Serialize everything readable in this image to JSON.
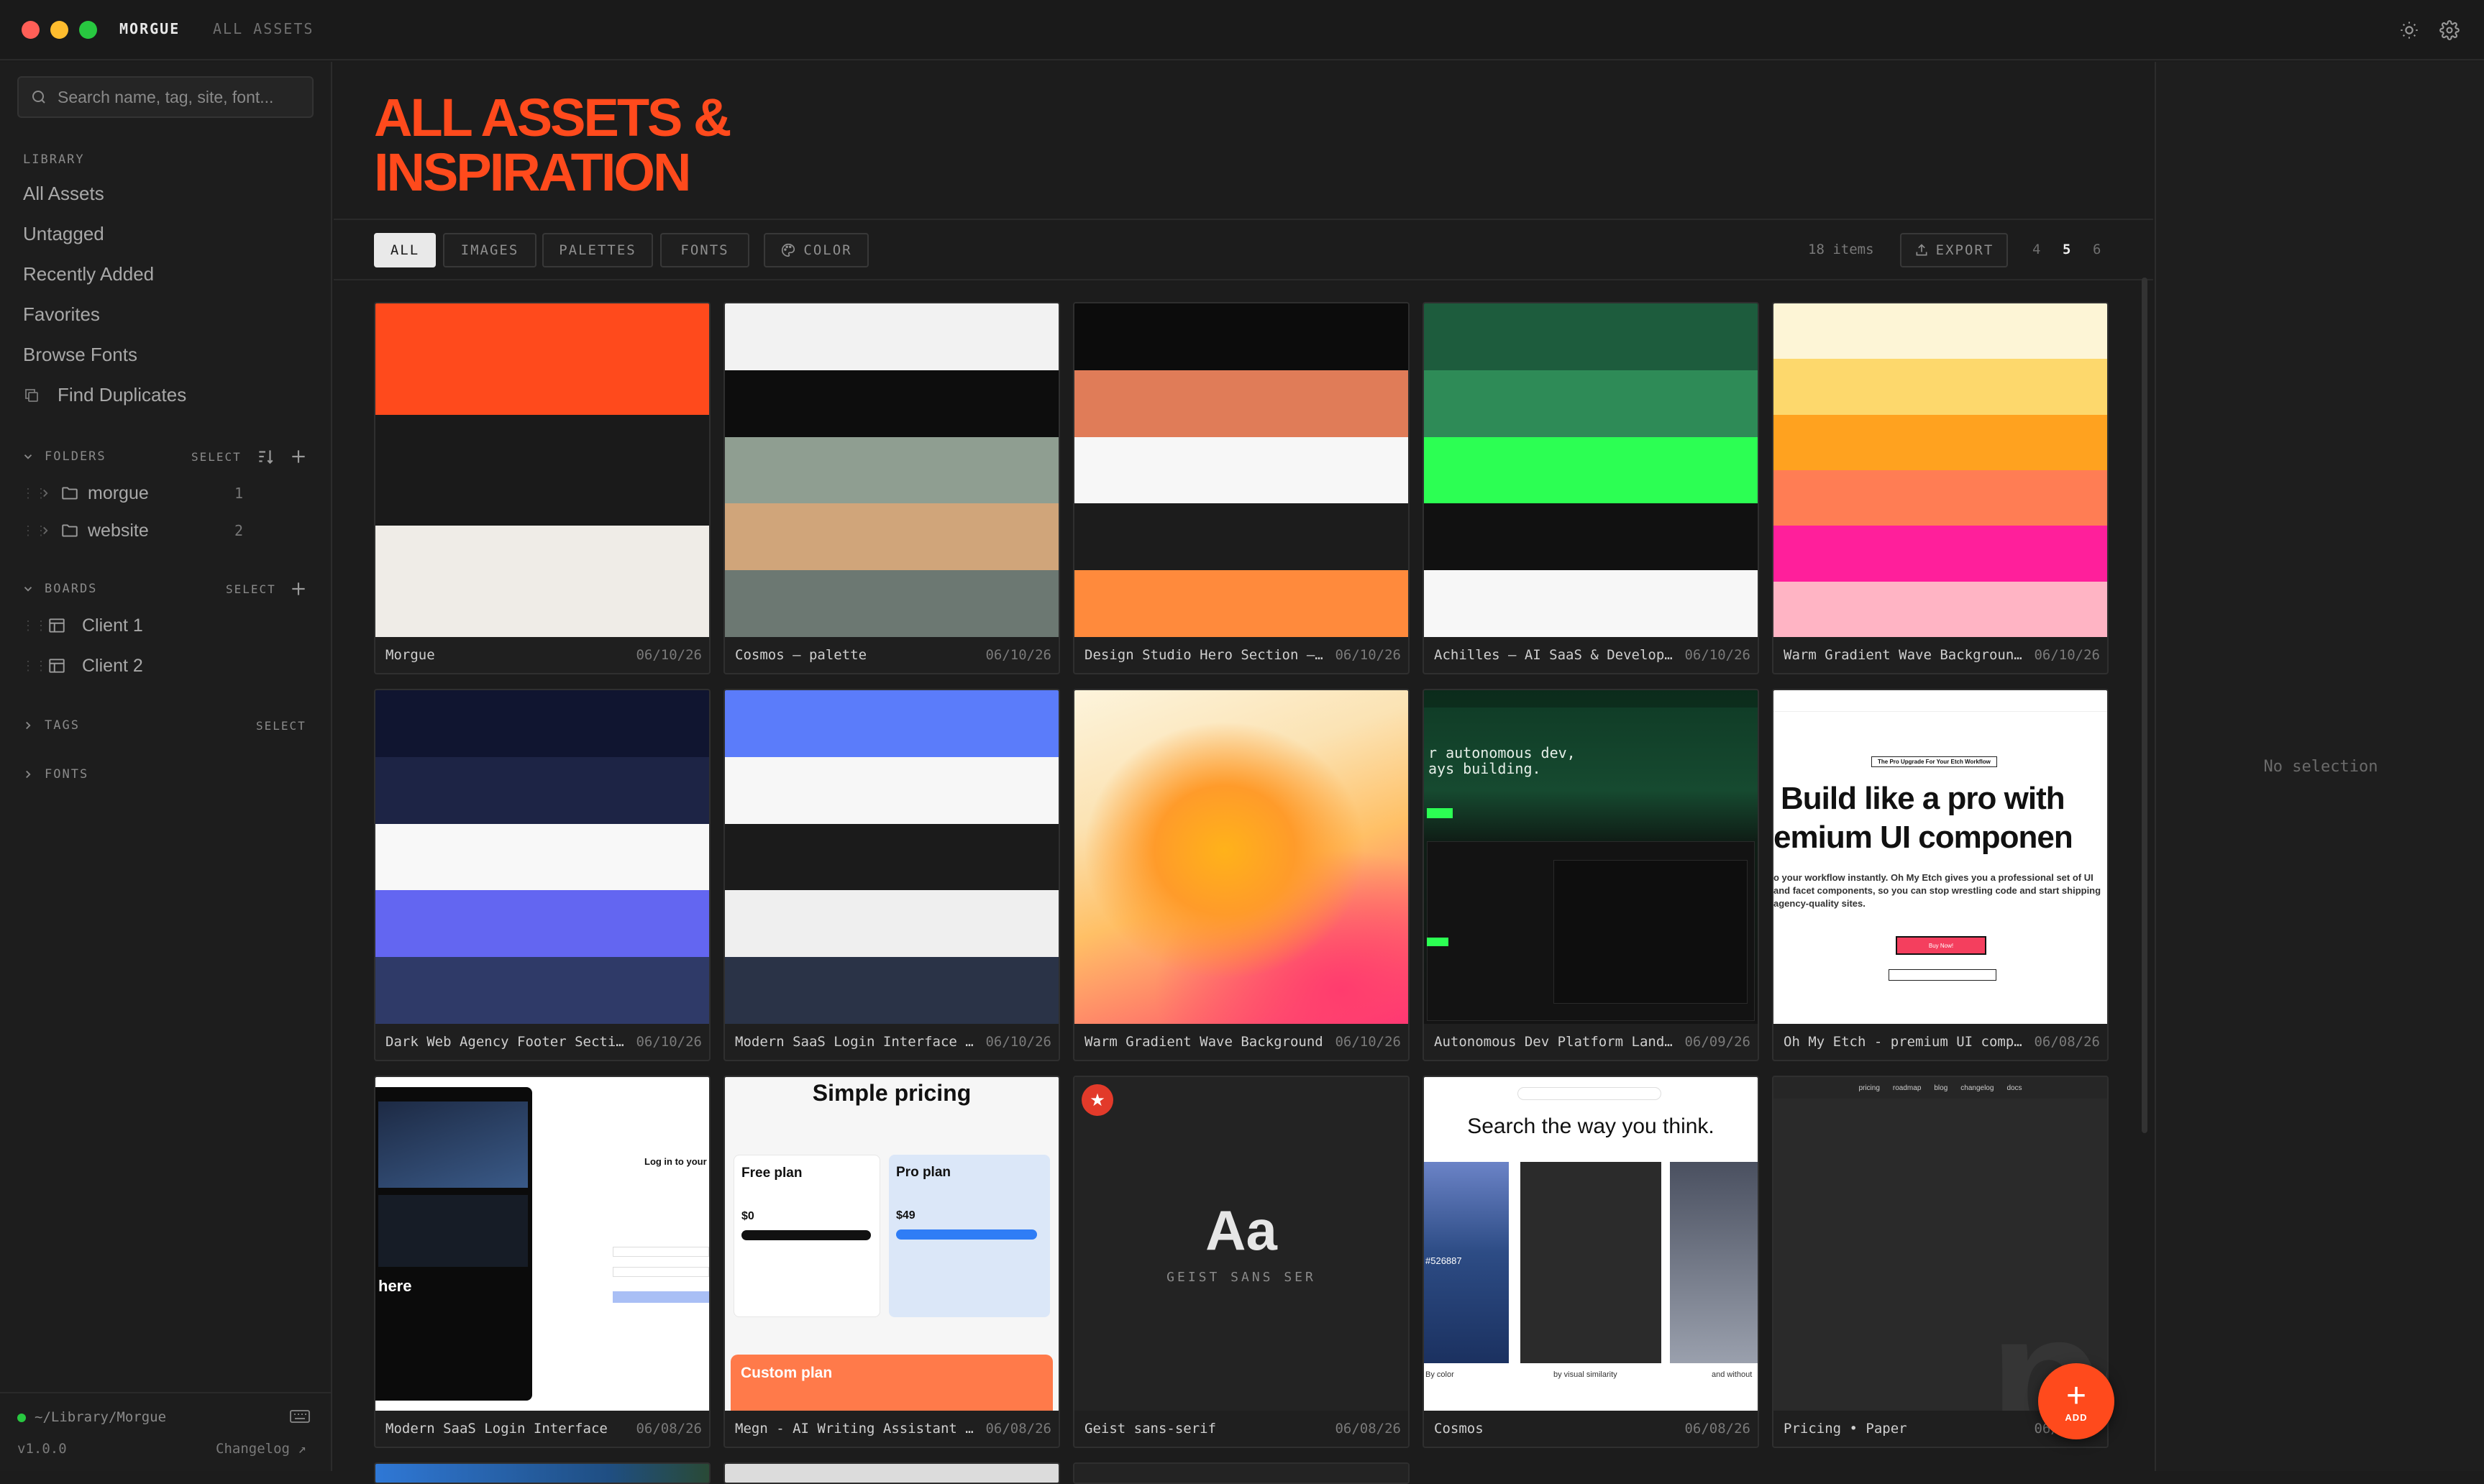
{
  "titlebar": {
    "app": "MORGUE",
    "view": "ALL ASSETS",
    "window_colors": [
      "#ff5f57",
      "#febc2e",
      "#28c840"
    ]
  },
  "sidebar": {
    "search_placeholder": "Search name, tag, site, font...",
    "library_label": "LIBRARY",
    "library_items": [
      "All Assets",
      "Untagged",
      "Recently Added",
      "Favorites",
      "Browse Fonts",
      "Find Duplicates"
    ],
    "folders": {
      "label": "FOLDERS",
      "select": "SELECT",
      "items": [
        {
          "name": "morgue",
          "count": "1"
        },
        {
          "name": "website",
          "count": "2"
        }
      ]
    },
    "boards": {
      "label": "BOARDS",
      "select": "SELECT",
      "items": [
        "Client 1",
        "Client 2"
      ]
    },
    "tags": {
      "label": "TAGS",
      "select": "SELECT"
    },
    "fonts": {
      "label": "FONTS"
    },
    "footer": {
      "path": "~/Library/Morgue",
      "version": "v1.0.0",
      "changelog": "Changelog ↗",
      "status_color": "#28c840"
    }
  },
  "main": {
    "title_line1": "ALL ASSETS &",
    "title_line2": "INSPIRATION",
    "accent": "#ff4a1c",
    "filters": [
      "ALL",
      "IMAGES",
      "PALETTES",
      "FONTS"
    ],
    "color_filter": "COLOR",
    "active_filter": "ALL",
    "item_count": "18 items",
    "export": "EXPORT",
    "columns": [
      "4",
      "5",
      "6"
    ],
    "active_columns": "5"
  },
  "cards": [
    {
      "name": "Morgue",
      "date": "06/10/26",
      "colors": [
        "#ff4a1c",
        "#1a1a1a",
        "#efece7"
      ]
    },
    {
      "name": "Cosmos — palette",
      "date": "06/10/26",
      "colors": [
        "#f2f2f2",
        "#0d0d0d",
        "#8f9e91",
        "#d0a57a",
        "#6c7872"
      ]
    },
    {
      "name": "Design Studio Hero Section — …",
      "date": "06/10/26",
      "colors": [
        "#0c0c0c",
        "#e07c58",
        "#f7f7f7",
        "#1c1c1c",
        "#ff8a3c"
      ]
    },
    {
      "name": "Achilles — AI SaaS & Develope…",
      "date": "06/10/26",
      "colors": [
        "#1d5c3d",
        "#2e8b57",
        "#2cff53",
        "#111111",
        "#f7f7f7"
      ]
    },
    {
      "name": "Warm Gradient Wave Background…",
      "date": "06/10/26",
      "colors": [
        "#fdf5d6",
        "#fdd86c",
        "#ffa21f",
        "#ff7d54",
        "#ff1f9b",
        "#ffb4c4"
      ]
    },
    {
      "name": "Dark Web Agency Footer Sectio…",
      "date": "06/10/26",
      "colors": [
        "#101530",
        "#1d2445",
        "#f8f8f8",
        "#6366f1",
        "#2f3a68"
      ]
    },
    {
      "name": "Modern SaaS Login Interface —…",
      "date": "06/10/26",
      "colors": [
        "#5b7cfa",
        "#f7f7f7",
        "#1b1b1b",
        "#efefef",
        "#2a3347"
      ]
    },
    {
      "name": "Warm Gradient Wave Background",
      "date": "06/10/26"
    },
    {
      "name": "Autonomous Dev Platform Landi…",
      "date": "06/09/26",
      "hero": [
        "r autonomous dev,",
        "ays building."
      ]
    },
    {
      "name": "Oh My Etch - premium UI compo…",
      "date": "06/08/26",
      "hero": [
        "Build like a pro with",
        "emium UI componen"
      ],
      "badge": "The Pro Upgrade For Your Etch Workflow",
      "body": "o your workflow instantly. Oh My Etch gives you a professional set of UI and facet components, so you can stop wrestling code and start shipping agency-quality sites.",
      "cta": "Buy Now!"
    },
    {
      "name": "Modern SaaS Login Interface",
      "date": "06/08/26",
      "hero": [
        "here"
      ],
      "login": "Log in to your o"
    },
    {
      "name": "Megn - AI Writing Assistant F…",
      "date": "06/08/26",
      "hero": [
        "Simple pricing"
      ],
      "plans": [
        "Free plan",
        "Pro plan",
        "Custom plan"
      ],
      "prices": [
        "$0",
        "$49"
      ]
    },
    {
      "name": "Geist sans-serif",
      "date": "06/08/26",
      "specimen": "Aa",
      "font_label": "GEIST SANS SER"
    },
    {
      "name": "Cosmos",
      "date": "06/08/26",
      "hero": [
        "Search the way you think."
      ],
      "tags": [
        "By color",
        "by visual similarity",
        "and without"
      ],
      "hex": "#526887"
    },
    {
      "name": "Pricing • Paper",
      "date": "06/08/26",
      "nav": [
        "pricing",
        "roadmap",
        "blog",
        "changelog",
        "docs"
      ]
    }
  ],
  "right_panel": {
    "empty": "No selection"
  },
  "fab": {
    "label": "ADD"
  }
}
